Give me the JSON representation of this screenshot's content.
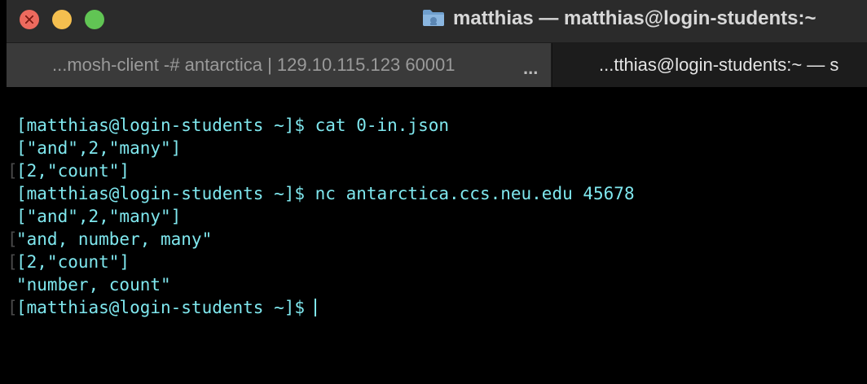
{
  "window": {
    "title": "matthias — matthias@login-students:~",
    "icon": "folder-icon",
    "colors": {
      "close": "#ed6a5e",
      "minimize": "#f5bf4f",
      "zoom": "#61c554",
      "terminal_text": "#7fe7ee",
      "terminal_bg": "#000000"
    }
  },
  "tabs": [
    {
      "label": "...mosh-client -# antarctica | 129.10.115.123 60001",
      "more": "...",
      "active": false
    },
    {
      "label": "...tthias@login-students:~ — s",
      "active": true
    }
  ],
  "terminal": {
    "lines": [
      "[matthias@login-students ~]$ cat 0-in.json",
      "[\"and\",2,\"many\"]",
      "[2,\"count\"]",
      "[matthias@login-students ~]$ nc antarctica.ccs.neu.edu 45678",
      "[\"and\",2,\"many\"]",
      "\"and, number, many\"",
      "[2,\"count\"]",
      "\"number, count\"",
      "[matthias@login-students ~]$"
    ],
    "margin_mark": "["
  }
}
